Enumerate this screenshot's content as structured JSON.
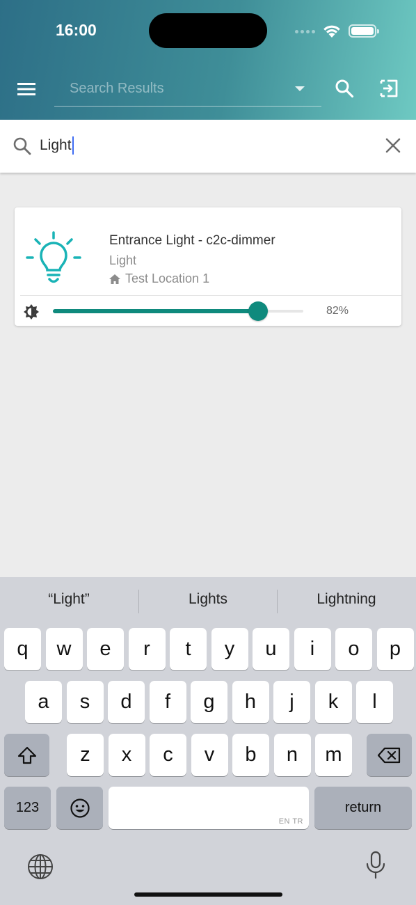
{
  "status_bar": {
    "time": "16:00"
  },
  "header": {
    "dropdown_placeholder": "Search Results",
    "icons": {
      "menu": "menu-icon",
      "search": "search-icon",
      "exit": "exit-icon"
    }
  },
  "search": {
    "value": "Light",
    "icon": "search-icon",
    "clear_icon": "close-icon"
  },
  "device_card": {
    "name": "Entrance Light - c2c-dimmer",
    "type": "Light",
    "location": "Test Location 1",
    "brightness_percent": 82,
    "brightness_label": "82%",
    "accent_color": "#0f8a7d",
    "bulb_color": "#19b3b6"
  },
  "keyboard": {
    "suggestions": [
      "“Light”",
      "Lights",
      "Lightning"
    ],
    "row1": [
      "q",
      "w",
      "e",
      "r",
      "t",
      "y",
      "u",
      "i",
      "o",
      "p"
    ],
    "row2": [
      "a",
      "s",
      "d",
      "f",
      "g",
      "h",
      "j",
      "k",
      "l"
    ],
    "row3": [
      "z",
      "x",
      "c",
      "v",
      "b",
      "n",
      "m"
    ],
    "numbers_label": "123",
    "space_tag": "EN TR",
    "return_label": "return"
  }
}
